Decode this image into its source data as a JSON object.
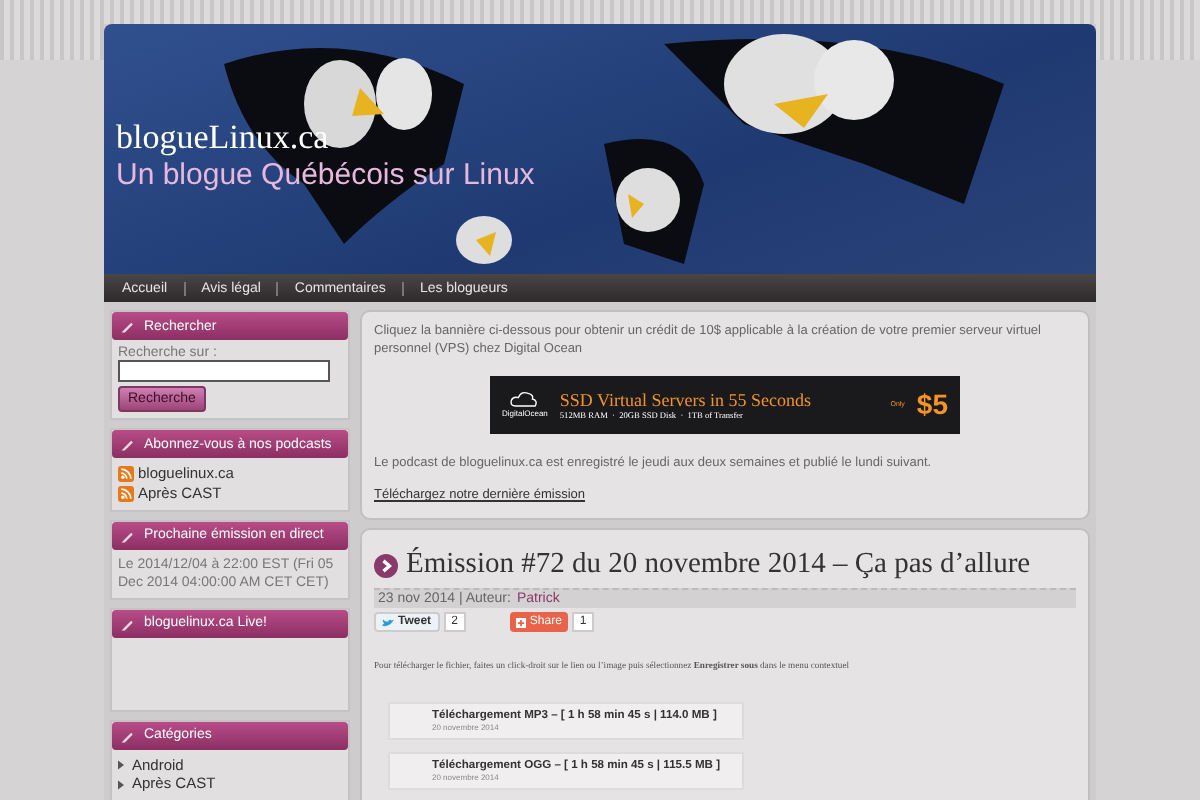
{
  "header": {
    "title": "blogueLinux.ca",
    "subtitle": "Un blogue Québécois sur Linux"
  },
  "nav": [
    {
      "label": "Accueil"
    },
    {
      "label": "Avis légal"
    },
    {
      "label": "Commentaires"
    },
    {
      "label": "Les blogueurs"
    }
  ],
  "sidebar": [
    {
      "kind": "search",
      "title": "Rechercher",
      "label": "Recherche sur :",
      "button": "Recherche"
    },
    {
      "kind": "feeds",
      "title": "Abonnez-vous à nos podcasts",
      "items": [
        "bloguelinux.ca",
        "Après CAST"
      ]
    },
    {
      "kind": "text",
      "title": "Prochaine émission en direct",
      "text": "Le 2014/12/04 à 22:00 EST (Fri 05 Dec 2014 04:00:00 AM CET CET)"
    },
    {
      "kind": "empty",
      "title": "bloguelinux.ca Live!"
    },
    {
      "kind": "list",
      "title": "Catégories",
      "items": [
        "Android",
        "Après CAST"
      ]
    }
  ],
  "intro": {
    "text": "Cliquez la bannière ci-dessous pour obtenir un crédit de 10$ applicable à la création de votre premier serveur virtuel personnel (VPS) chez Digital Ocean",
    "ad": {
      "brand": "DigitalOcean",
      "headline": "SSD Virtual Servers in 55 Seconds",
      "specs": "512MB RAM  ·  20GB SSD Disk  ·  1TB of Transfer",
      "only": "Only",
      "price": "$5"
    },
    "note": "Le podcast de bloguelinux.ca est enregistré le jeudi aux deux semaines et publié le lundi suivant.",
    "link": "Téléchargez notre dernière émission"
  },
  "post": {
    "title": "Émission #72 du 20 novembre 2014 – Ça pas d’allure",
    "date": "23 nov 2014 | Auteur:",
    "author": "Patrick",
    "tweet": "Tweet",
    "tweet_count": "2",
    "share": "Share",
    "share_count": "1",
    "text": "Pour télécharger le fichier, faites un click-droit sur le lien ou l’image puis sélectionnez **Enregistrer sous** dans le menu contextuel",
    "downloads": [
      {
        "title": "Téléchargement MP3 – [ 1 h 58 min 45 s | 114.0 MB ]",
        "date": "20 novembre 2014"
      },
      {
        "title": "Téléchargement OGG – [ 1 h 58 min 45 s | 115.5 MB ]",
        "date": "20 novembre 2014"
      }
    ]
  }
}
